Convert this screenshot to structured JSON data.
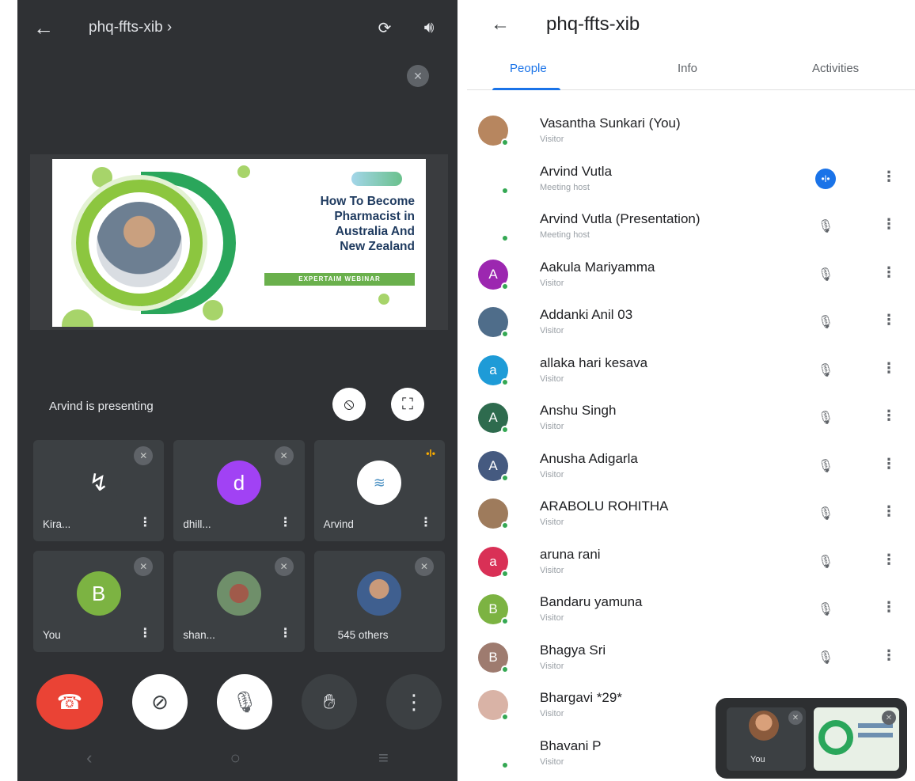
{
  "meeting": {
    "code_left": "phq-ffts-xib ›",
    "code_right": "phq-ffts-xib",
    "back_glyph": "←"
  },
  "slide": {
    "heading_lines": [
      "How To Become",
      "Pharmacist in",
      "Australia And",
      "New Zealand"
    ],
    "band_text": "EXPERTAIM WEBINAR"
  },
  "presenting_text": "Arvind is presenting",
  "tiles": [
    {
      "name": "Kira...",
      "avatar_text": "",
      "avatar_color": "#3c4043",
      "icon": "mic-off-icon"
    },
    {
      "name": "dhill...",
      "avatar_text": "d",
      "avatar_color": "#a142f4",
      "icon": "mic-off-icon"
    },
    {
      "name": "Arvind",
      "avatar_text": "",
      "avatar_color": "#ffffff",
      "icon": "speaking-icon"
    },
    {
      "name": "You",
      "avatar_text": "B",
      "avatar_color": "#7cb342",
      "icon": "mic-off-icon"
    },
    {
      "name": "shan...",
      "avatar_text": "",
      "avatar_color": "#8d6e63",
      "icon": "mic-off-icon"
    },
    {
      "name": "545 others",
      "avatar_text": "",
      "avatar_color": "#5f7d95",
      "icon": "mic-off-icon"
    }
  ],
  "tabs": {
    "people": "People",
    "info": "Info",
    "activities": "Activities"
  },
  "people": [
    {
      "name": "Vasantha Sunkari (You)",
      "role": "Visitor",
      "avatar_text": "",
      "avatar_color": "#b7865f",
      "mic": "none"
    },
    {
      "name": "Arvind Vutla",
      "role": "Meeting host",
      "avatar_text": "",
      "avatar_color": "#ffffff",
      "mic": "active"
    },
    {
      "name": "Arvind Vutla (Presentation)",
      "role": "Meeting host",
      "avatar_text": "",
      "avatar_color": "#ffffff",
      "mic": "muted"
    },
    {
      "name": "Aakula Mariyamma",
      "role": "Visitor",
      "avatar_text": "A",
      "avatar_color": "#9c27b0",
      "mic": "muted"
    },
    {
      "name": "Addanki Anil 03",
      "role": "Visitor",
      "avatar_text": "",
      "avatar_color": "#4f6d8a",
      "mic": "muted"
    },
    {
      "name": "allaka hari kesava",
      "role": "Visitor",
      "avatar_text": "a",
      "avatar_color": "#1e9bd7",
      "mic": "muted"
    },
    {
      "name": "Anshu Singh",
      "role": "Visitor",
      "avatar_text": "A",
      "avatar_color": "#2e6b4e",
      "mic": "muted"
    },
    {
      "name": "Anusha Adigarla",
      "role": "Visitor",
      "avatar_text": "A",
      "avatar_color": "#455a80",
      "mic": "muted"
    },
    {
      "name": "ARABOLU ROHITHA",
      "role": "Visitor",
      "avatar_text": "",
      "avatar_color": "#9e7b5c",
      "mic": "muted"
    },
    {
      "name": "aruna rani",
      "role": "Visitor",
      "avatar_text": "a",
      "avatar_color": "#d93056",
      "mic": "muted"
    },
    {
      "name": "Bandaru yamuna",
      "role": "Visitor",
      "avatar_text": "B",
      "avatar_color": "#7cb342",
      "mic": "muted"
    },
    {
      "name": "Bhagya Sri",
      "role": "Visitor",
      "avatar_text": "B",
      "avatar_color": "#9e7b6f",
      "mic": "muted"
    },
    {
      "name": "Bhargavi *29*",
      "role": "Visitor",
      "avatar_text": "",
      "avatar_color": "#d9b3a6",
      "mic": "none"
    },
    {
      "name": "Bhavani P",
      "role": "Visitor",
      "avatar_text": "",
      "avatar_color": "#ffffff",
      "mic": "none"
    }
  ],
  "pip": {
    "you_label": "You"
  },
  "colors": {
    "accent": "#1a73e8",
    "end_call": "#ea4335",
    "online": "#34a853"
  }
}
